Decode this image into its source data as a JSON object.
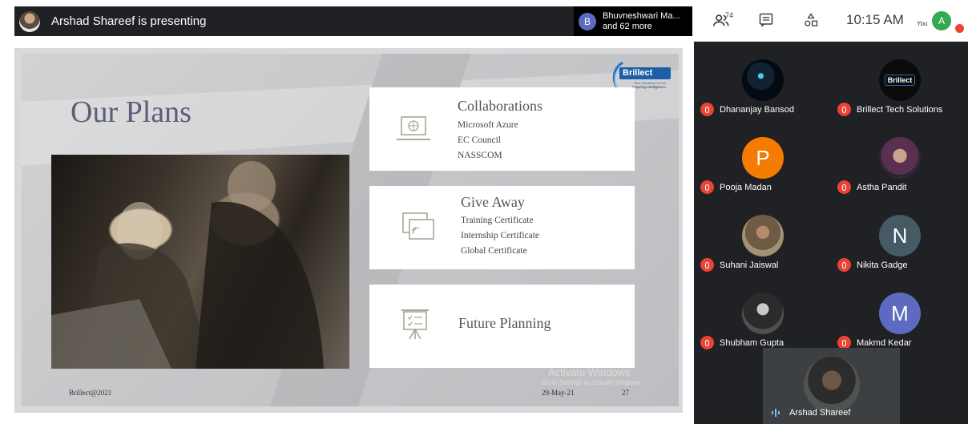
{
  "presenter_bar": {
    "text": "Arshad Shareef is presenting"
  },
  "viewer": {
    "initial": "B",
    "name": "Bhuvneshwari Ma...",
    "more": "and 62 more"
  },
  "controls": {
    "people_count": "74",
    "time": "10:15 AM",
    "you_label": "You",
    "you_initial": "A"
  },
  "slide": {
    "title": "Our Plans",
    "logo_text": "Brillect",
    "logo_sub": "Tech Solutions Pvt Ltd",
    "logo_tagline": "Inspiring Intelligence...",
    "cards": [
      {
        "title": "Collaborations",
        "items": [
          "Microsoft Azure",
          "EC Council",
          "NASSCOM"
        ]
      },
      {
        "title": "Give Away",
        "items": [
          "Training Certificate",
          "Internship Certificate",
          "Global Certificate"
        ]
      },
      {
        "title": "Future Planning",
        "items": []
      }
    ],
    "footer_left": "Brillect@2021",
    "footer_date": "29-May-21",
    "footer_page": "27",
    "watermark_title": "Activate Windows",
    "watermark_sub": "Go to Settings to activate Windows."
  },
  "participants": [
    {
      "name": "Dhananjay Bansod",
      "initial": "",
      "color": "#0d1b2a"
    },
    {
      "name": "Brillect Tech Solutions",
      "initial": "",
      "color": "#0b0b0b"
    },
    {
      "name": "Pooja Madan",
      "initial": "P",
      "color": "#f57c00"
    },
    {
      "name": "Astha Pandit",
      "initial": "",
      "color": "#4a3b52"
    },
    {
      "name": "Suhani Jaiswal",
      "initial": "",
      "color": "#8d6e4f"
    },
    {
      "name": "Nikita Gadge",
      "initial": "N",
      "color": "#455a64"
    },
    {
      "name": "Shubham Gupta",
      "initial": "",
      "color": "#3a3a3a"
    },
    {
      "name": "Makmd Kedar",
      "initial": "M",
      "color": "#5c6bc0"
    }
  ],
  "active_speaker": {
    "name": "Arshad Shareef"
  }
}
